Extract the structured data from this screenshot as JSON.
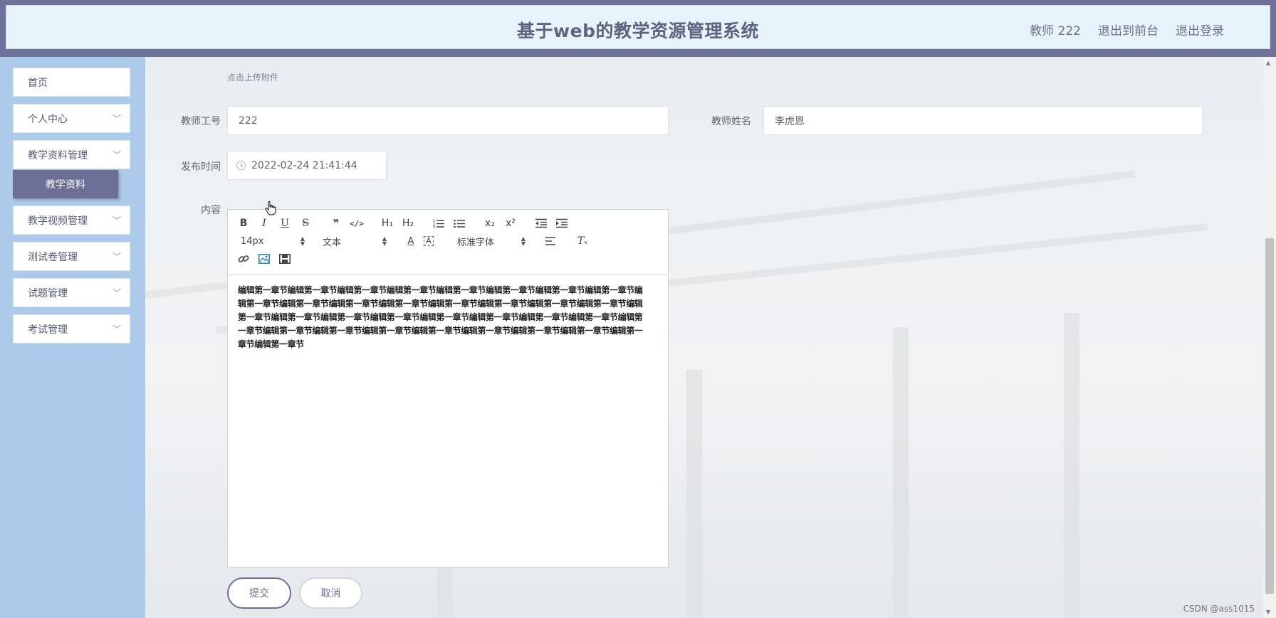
{
  "header": {
    "title": "基于web的教学资源管理系统",
    "user_label": "教师 222",
    "front_link": "退出到前台",
    "logout_link": "退出登录"
  },
  "sidebar": {
    "items": [
      {
        "label": "首页"
      },
      {
        "label": "个人中心"
      },
      {
        "label": "教学资料管理"
      },
      {
        "label": "教学视频管理"
      },
      {
        "label": "测试卷管理"
      },
      {
        "label": "试题管理"
      },
      {
        "label": "考试管理"
      }
    ],
    "submenu_active": "教学资料"
  },
  "form": {
    "upload_hint": "点击上传附件",
    "teacher_id_label": "教师工号",
    "teacher_id_value": "222",
    "teacher_name_label": "教师姓名",
    "teacher_name_value": "李虎恩",
    "publish_time_label": "发布时间",
    "publish_time_value": "2022-02-24 21:41:44",
    "content_label": "内容"
  },
  "editor": {
    "font_size": "14px",
    "header_select": "文本",
    "font_family": "标准字体",
    "content": "编辑第一章节编辑第一章节编辑第一章节编辑第一章节编辑第一章节编辑第一章节编辑第一章节编辑第一章节编辑第一章节编辑第一章节编辑第一章节编辑第一章节编辑第一章节编辑第一章节编辑第一章节编辑第一章节编辑第一章节编辑第一章节编辑第一章节编辑第一章节编辑第一章节编辑第一章节编辑第一章节编辑第一章节编辑第一章节编辑第一章节编辑第一章节编辑第一章节编辑第一章节编辑第一章节编辑第一章节编辑第一章节编辑第一章节编辑第一章节",
    "toolbar_glyphs": {
      "bold": "B",
      "italic": "I",
      "underline": "U",
      "strike": "S",
      "quote": "❞",
      "code": "</>",
      "h1": "H₁",
      "h2": "H₂",
      "sub": "x₂",
      "sup": "x²",
      "text_color": "A",
      "bg_color": "A",
      "clean": "Tₓ"
    }
  },
  "actions": {
    "submit": "提交",
    "cancel": "取消"
  },
  "watermark": "CSDN @ass1015",
  "colors": {
    "header_frame": "#6e7199",
    "header_bg": "#e7f3fb",
    "sidebar_bg": "#accbea",
    "accent": "#6b6e95",
    "active_image_icon": "#2a84d8"
  },
  "icons": [
    "clock-icon",
    "link-icon",
    "image-icon",
    "video-icon",
    "chevron-down-icon",
    "hand-pointer-icon"
  ]
}
